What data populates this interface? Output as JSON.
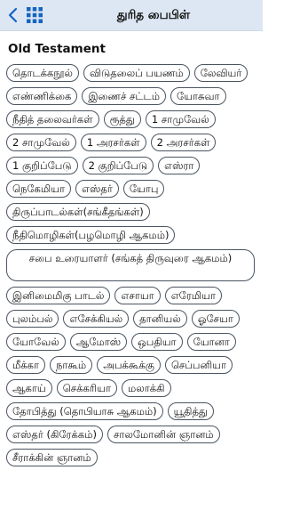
{
  "header": {
    "title": "துரித பைபிள்",
    "back_icon": "chevron-left-icon",
    "grid_icon": "grid-menu-icon",
    "accent": "#1565c0",
    "background": "#dde7f3"
  },
  "section": {
    "title": "Old Testament"
  },
  "books": [
    "தொடக்கநூல்",
    "விடுதலைப் பயணம்",
    "லேவியர்",
    "எண்ணிக்கை",
    "இணைச் சட்டம்",
    "யோசுவா",
    "நீதித் தலைவர்கள்",
    "ரூத்து",
    "1 சாமுவேல்",
    "2 சாமுவேல்",
    "1 அரசர்கள்",
    "2 அரசர்கள்",
    "1 குறிப்பேடு",
    "2 குறிப்பேடு",
    "எஸ்ரா",
    "நெகேமியா",
    "எஸ்தர்",
    "யோபு",
    "திருப்பாடல்கள்(சங்கீதங்கள்)",
    "நீதிமொழிகள்(பழமொழி ஆகமம்)",
    "சபை உரையாளர் (சங்கத் திருவுரை ஆகமம்)",
    "இனிமைமிகு பாடல்",
    "எசாயா",
    "எரேமியா",
    "புலம்பல்",
    "எசேக்கியல்",
    "தானியல்",
    "ஓசேயா",
    "யோவேல்",
    "ஆமோஸ்",
    "ஒபதியா",
    "யோனா",
    "மீக்கா",
    "நாகூம்",
    "அபக்கூக்கு",
    "செப்பனியா",
    "ஆகாய்",
    "செக்கரியா",
    "மலாக்கி",
    "தோபித்து (தொபியாசு ஆகமம்)",
    "யூதித்து",
    "எஸ்தர் (கிரேக்கம்)",
    "சாலமோனின் ஞானம்",
    "சீராக்கின் ஞானம்"
  ]
}
